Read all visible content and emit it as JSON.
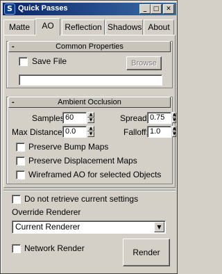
{
  "window": {
    "title": "Quick Passes",
    "controls": {
      "minimize": "_",
      "maximize": "□",
      "close": "✕"
    },
    "icon": "app-icon"
  },
  "tabs": [
    {
      "label": "Matte",
      "active": false
    },
    {
      "label": "AO",
      "active": true
    },
    {
      "label": "Reflection",
      "active": false
    },
    {
      "label": "Shadows",
      "active": false
    },
    {
      "label": "About",
      "active": false
    }
  ],
  "common": {
    "header": "Common Properties",
    "toggle": "-",
    "save_file_label": "Save File",
    "save_file_checked": false,
    "browse_label": "Browse",
    "file_path": ""
  },
  "ao": {
    "header": "Ambient Occlusion",
    "toggle": "-",
    "samples_label": "Samples",
    "samples_value": "60",
    "spread_label": "Spread:",
    "spread_value": "0.75",
    "max_distance_label": "Max Distance:",
    "max_distance_value": "0.0",
    "falloff_label": "Falloff:",
    "falloff_value": "1.0",
    "preserve_bump_label": "Preserve Bump Maps",
    "preserve_displacement_label": "Preserve Displacement Maps",
    "wireframed_label": "Wireframed AO for selected Objects"
  },
  "footer": {
    "do_not_retrieve_label": "Do not retrieve current settings",
    "override_renderer_label": "Override Renderer",
    "renderer_value": "Current Renderer",
    "network_render_label": "Network Render",
    "render_button_label": "Render"
  },
  "spinner_glyphs": {
    "up": "▲",
    "down": "▼"
  },
  "combo_arrow": "▼",
  "colors": {
    "title_start": "#0a246a",
    "title_end": "#3a6ea5",
    "face": "#d4d0c8"
  }
}
